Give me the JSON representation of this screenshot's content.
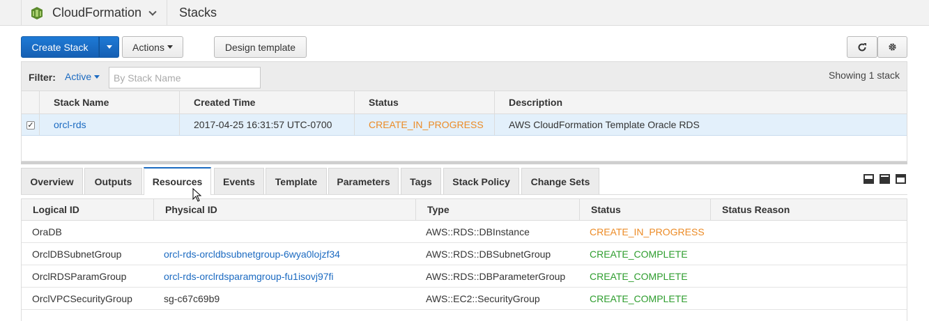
{
  "topbar": {
    "service": "CloudFormation",
    "page_title": "Stacks"
  },
  "toolbar": {
    "create_stack": "Create Stack",
    "actions": "Actions",
    "design_template": "Design template",
    "refresh_icon": "refresh-icon",
    "settings_icon": "gear-icon"
  },
  "filter": {
    "label": "Filter:",
    "active": "Active",
    "placeholder": "By Stack Name",
    "showing": "Showing 1 stack"
  },
  "stacks": {
    "columns": [
      "Stack Name",
      "Created Time",
      "Status",
      "Description"
    ],
    "rows": [
      {
        "name": "orcl-rds",
        "created": "2017-04-25 16:31:57 UTC-0700",
        "status": "CREATE_IN_PROGRESS",
        "description": "AWS CloudFormation Template Oracle RDS",
        "checked": true
      }
    ]
  },
  "tabs": [
    "Overview",
    "Outputs",
    "Resources",
    "Events",
    "Template",
    "Parameters",
    "Tags",
    "Stack Policy",
    "Change Sets"
  ],
  "active_tab": "Resources",
  "resources": {
    "columns": [
      "Logical ID",
      "Physical ID",
      "Type",
      "Status",
      "Status Reason"
    ],
    "rows": [
      {
        "logical": "OraDB",
        "physical": "",
        "type": "AWS::RDS::DBInstance",
        "status": "CREATE_IN_PROGRESS",
        "reason": ""
      },
      {
        "logical": "OrclDBSubnetGroup",
        "physical": "orcl-rds-orcldbsubnetgroup-6wya0lojzf34",
        "type": "AWS::RDS::DBSubnetGroup",
        "status": "CREATE_COMPLETE",
        "reason": ""
      },
      {
        "logical": "OrclRDSParamGroup",
        "physical": "orcl-rds-orclrdsparamgroup-fu1isovj97fi",
        "type": "AWS::RDS::DBParameterGroup",
        "status": "CREATE_COMPLETE",
        "reason": ""
      },
      {
        "logical": "OrclVPCSecurityGroup",
        "physical": "sg-c67c69b9",
        "type": "AWS::EC2::SecurityGroup",
        "status": "CREATE_COMPLETE",
        "reason": ""
      }
    ]
  },
  "colors": {
    "link": "#1b6ac1",
    "in_progress": "#ec8b26",
    "complete": "#2e9d2e",
    "primary": "#1a6fc9"
  }
}
